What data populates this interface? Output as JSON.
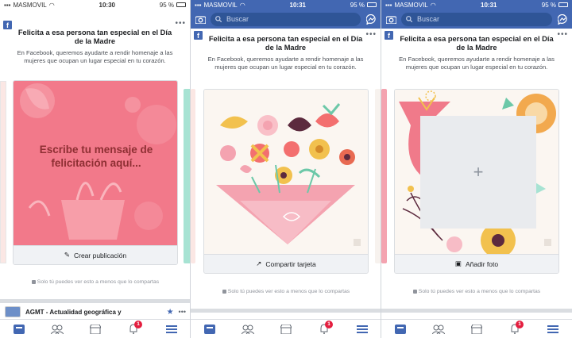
{
  "status": {
    "carrier": "MASMOVIL",
    "panel1_time": "10:30",
    "panel2_time": "10:31",
    "panel3_time": "10:31",
    "battery": "95 %"
  },
  "search": {
    "placeholder": "Buscar"
  },
  "header": {
    "title": "Felicita a esa persona tan especial en el Día de la Madre",
    "subtitle": "En Facebook, queremos ayudarte a rendir homenaje a las mujeres que ocupan un lugar especial en tu corazón."
  },
  "cards": {
    "write_message_text": "Escribe tu mensaje de felicitación aquí...",
    "create_post_label": "Crear publicación",
    "share_card_label": "Compartir tarjeta",
    "add_photo_label": "Añadir foto"
  },
  "privacy_note": "Solo tú puedes ver esto a menos que lo compartas",
  "post": {
    "author": "AGMT - Actualidad geográfica y"
  },
  "tabs": {
    "notifications_badge": "1"
  },
  "colors": {
    "facebook_blue": "#4267b2",
    "card_pink": "#f2798a",
    "badge_red": "#e41e3f"
  }
}
